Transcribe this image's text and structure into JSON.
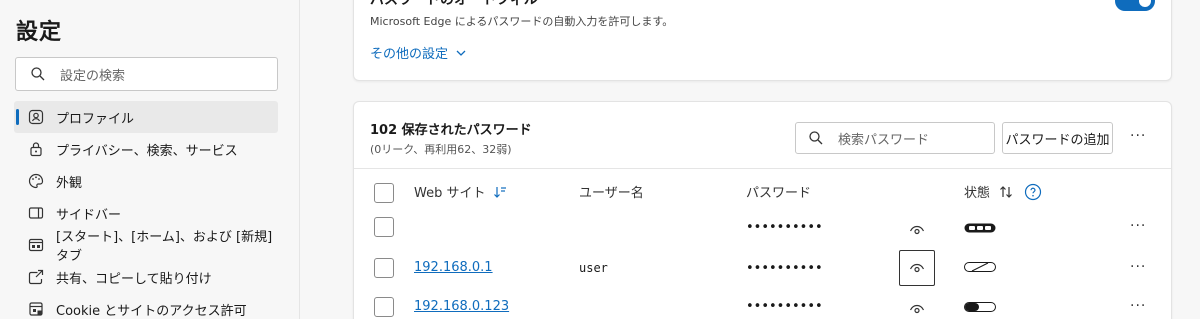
{
  "sidebar": {
    "title": "設定",
    "search_placeholder": "設定の検索",
    "items": [
      {
        "label": "プロファイル",
        "icon": "profile-icon",
        "active": true
      },
      {
        "label": "プライバシー、検索、サービス",
        "icon": "lock-icon"
      },
      {
        "label": "外観",
        "icon": "palette-icon"
      },
      {
        "label": "サイドバー",
        "icon": "sidebar-icon"
      },
      {
        "label": "[スタート]、[ホーム]、および [新規] タブ",
        "icon": "home-tab-icon"
      },
      {
        "label": "共有、コピーして貼り付け",
        "icon": "share-icon"
      },
      {
        "label": "Cookie とサイトのアクセス許可",
        "icon": "cookie-icon"
      }
    ]
  },
  "autofill": {
    "title": "パスワードのオートフィル",
    "description": "Microsoft Edge によるパスワードの自動入力を許可します。",
    "more_settings": "その他の設定",
    "toggle_on": true
  },
  "passwords": {
    "count_label": "102 保存されたパスワード",
    "summary": "(0リーク、再利用62、32弱)",
    "search_placeholder": "検索パスワード",
    "add_button": "パスワードの追加",
    "more": "···",
    "columns": {
      "website": "Web サイト",
      "username": "ユーザー名",
      "password": "パスワード",
      "status": "状態"
    },
    "rows": [
      {
        "site": "",
        "username": "",
        "password": "••••••••••",
        "more": "···",
        "strength": "strong"
      },
      {
        "site": "192.168.0.1",
        "username": "user",
        "password": "••••••••••",
        "more": "···",
        "strength": "weak"
      },
      {
        "site": "192.168.0.123",
        "username": "",
        "password": "••••••••••",
        "more": "···",
        "strength": "medium"
      }
    ]
  },
  "colors": {
    "accent": "#0f6cbd"
  }
}
